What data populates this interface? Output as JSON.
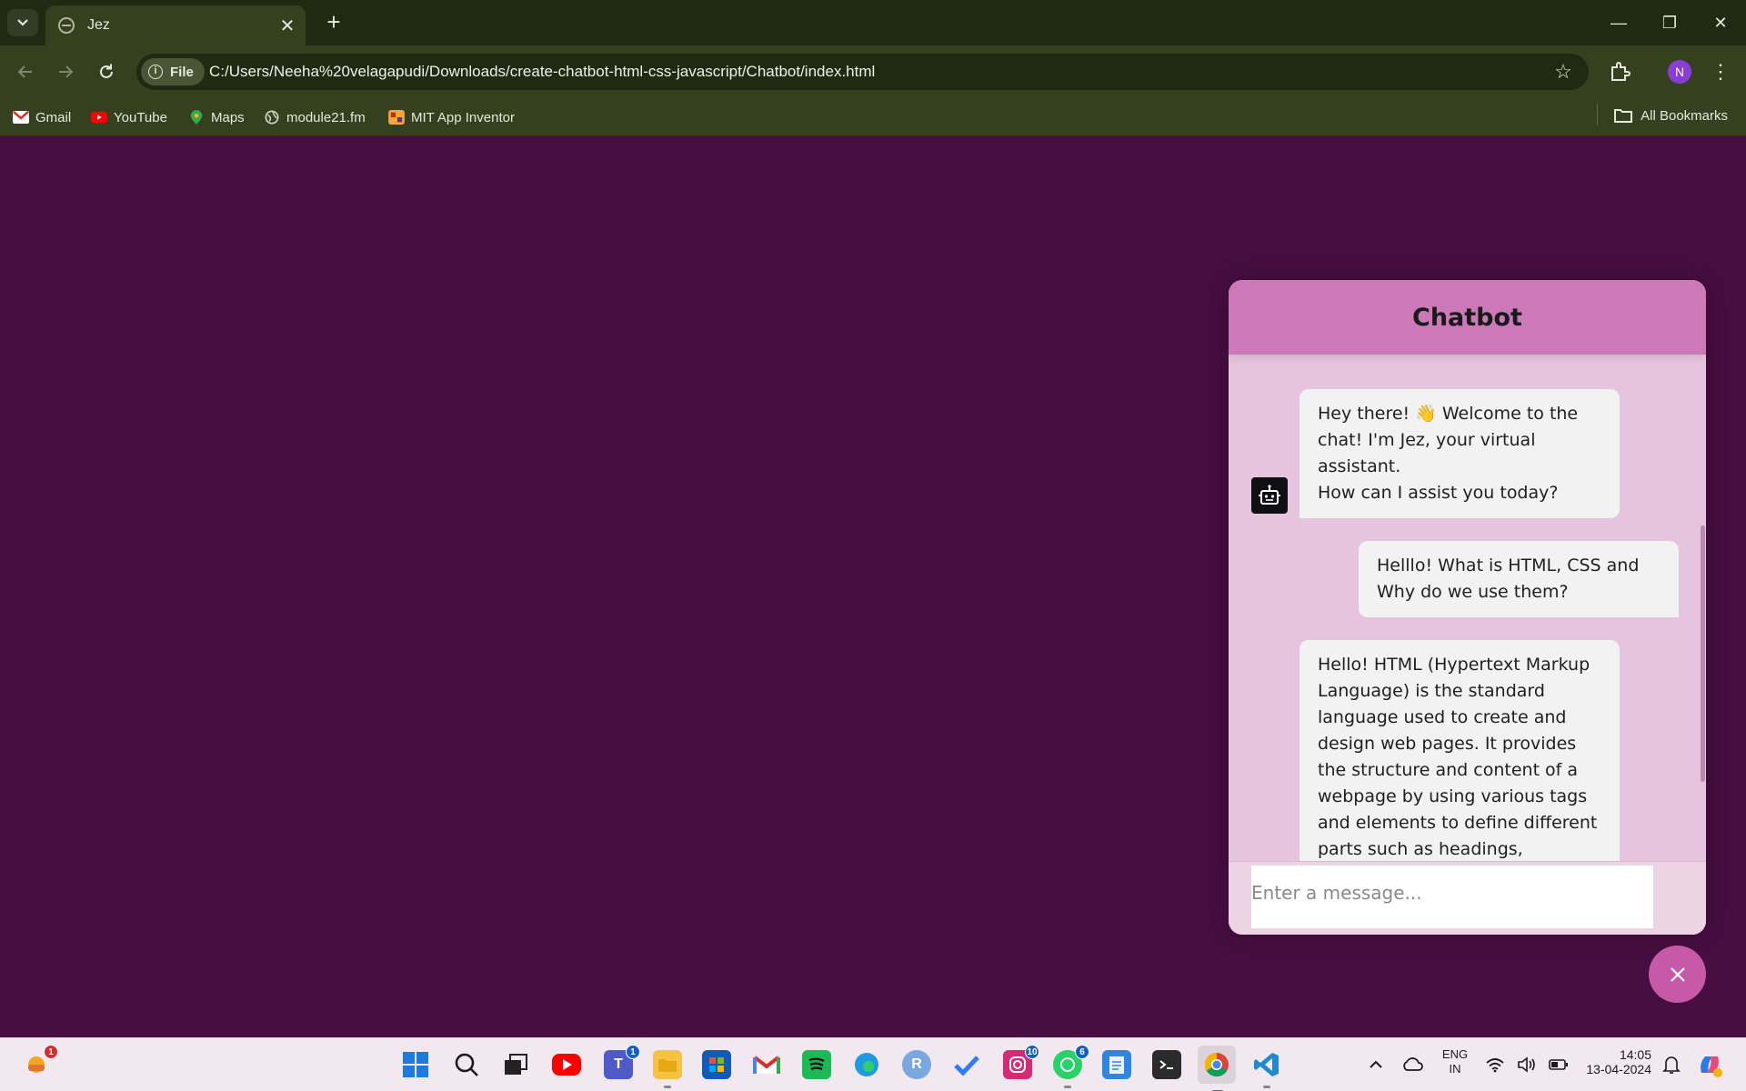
{
  "browser": {
    "tab_title": "Jez",
    "address_chip": "File",
    "url": "C:/Users/Neeha%20velagapudi/Downloads/create-chatbot-html-css-javascript/Chatbot/index.html",
    "profile_initial": "N",
    "bookmarks": [
      {
        "label": "Gmail",
        "icon": "gmail-icon"
      },
      {
        "label": "YouTube",
        "icon": "youtube-icon"
      },
      {
        "label": "Maps",
        "icon": "maps-icon"
      },
      {
        "label": "module21.fm",
        "icon": "globe-icon"
      },
      {
        "label": "MIT App Inventor",
        "icon": "app-inventor-icon"
      }
    ],
    "all_bookmarks": "All Bookmarks"
  },
  "chatbot": {
    "title": "Chatbot",
    "messages": [
      {
        "role": "incoming",
        "text": "Hey there! 👋 Welcome to the chat! I'm Jez, your virtual assistant.\nHow can I assist you today?"
      },
      {
        "role": "outgoing",
        "text": "Helllo! What is HTML, CSS and Why do we use them?"
      },
      {
        "role": "incoming",
        "text": "Hello! HTML (Hypertext Markup Language) is the standard language used to create and design web pages. It provides the structure and content of a webpage by using various tags and elements to define different parts such as headings,"
      }
    ],
    "input_placeholder": "Enter a message..."
  },
  "taskbar": {
    "weather_badge": "1",
    "teams_badge": "1",
    "instagram_badge": "10",
    "whatsapp_badge": "6",
    "r_label": "R",
    "lang_line1": "ENG",
    "lang_line2": "IN",
    "time": "14:05",
    "date": "13-04-2024"
  },
  "colors": {
    "page_bg": "#470e41",
    "chat_header": "#cd78b8",
    "chat_body": "#e6c4dd",
    "toggler": "#c65aa8"
  }
}
